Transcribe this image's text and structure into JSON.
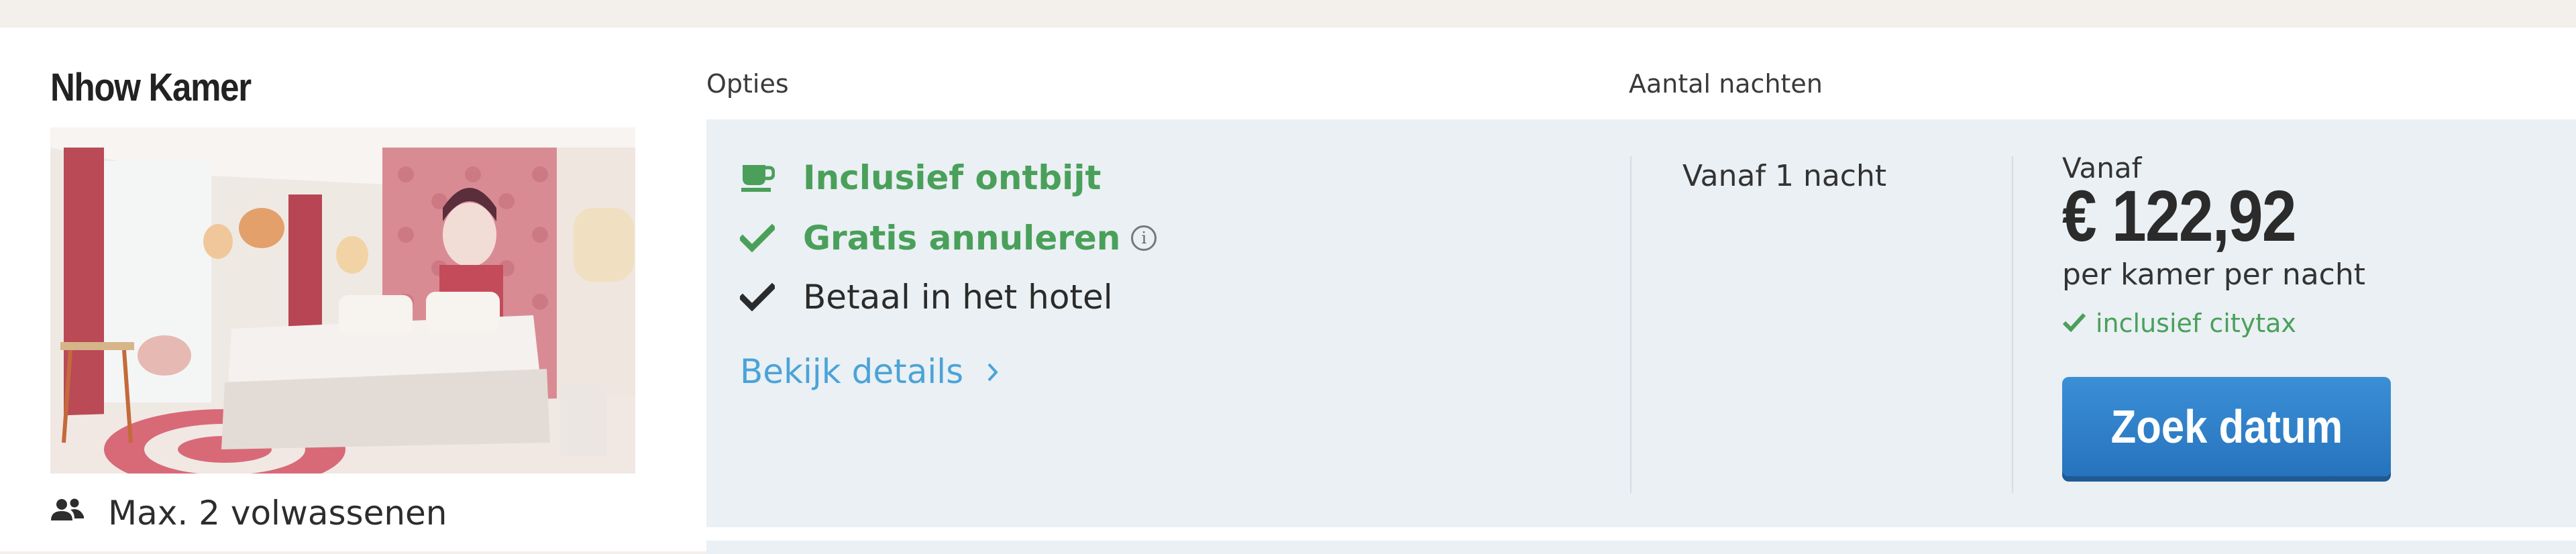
{
  "room": {
    "title": "Nhow Kamer",
    "capacity": "Max. 2 volwassenen",
    "capacity_icon": "users-icon",
    "photo_icon": "hotel-room-photo"
  },
  "columns": {
    "options": "Opties",
    "nights": "Aantal nachten"
  },
  "options": [
    {
      "label": "Inclusief ontbijt",
      "icon": "coffee-cup-icon",
      "color": "#4aa05a"
    },
    {
      "label": "Gratis annuleren",
      "icon": "checkmark-icon",
      "color": "#4aa05a",
      "info_icon": "info-icon"
    },
    {
      "label": "Betaal in het hotel",
      "icon": "checkmark-icon",
      "color": "#2b2b2b"
    }
  ],
  "details_link": {
    "label": "Bekijk details",
    "icon": "chevron-right-icon"
  },
  "nights": {
    "value": "Vanaf 1 nacht"
  },
  "price": {
    "from": "Vanaf",
    "amount": "€ 122,92",
    "per": "per kamer per nacht",
    "citytax": "inclusief citytax"
  },
  "cta": {
    "label": "Zoek datum",
    "color": "#2f80cc"
  },
  "colors": {
    "background": "#f3efeb",
    "panel": "#eaf0f3",
    "accent_green": "#4aa05a",
    "link": "#4ba3d8"
  }
}
